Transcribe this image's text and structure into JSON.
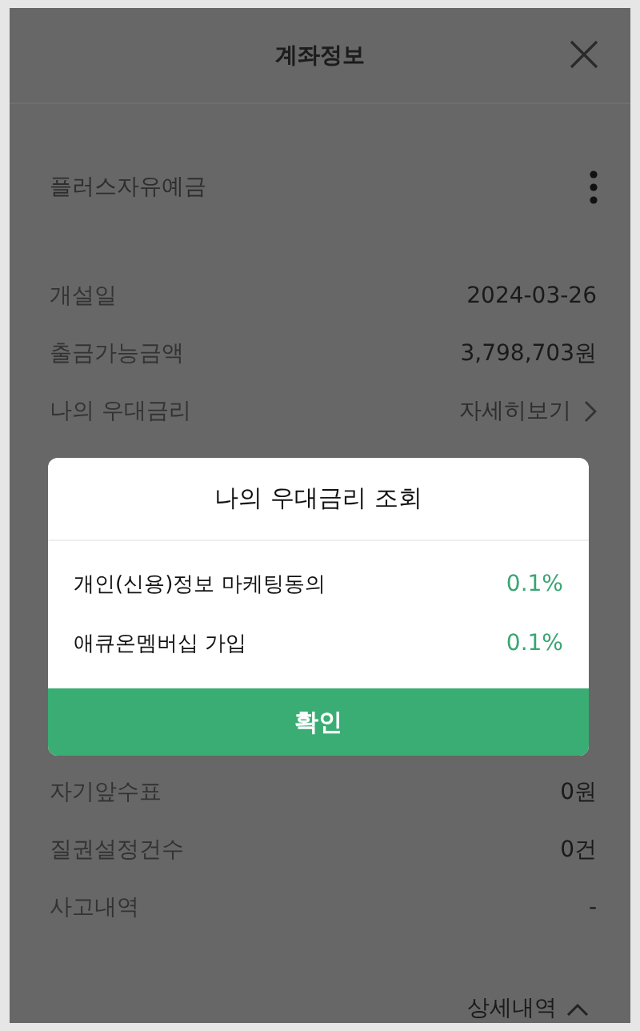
{
  "header": {
    "title": "계좌정보"
  },
  "product": {
    "name": "플러스자유예금"
  },
  "details_top": [
    {
      "kind": "value",
      "label": "개설일",
      "value": "2024-03-26"
    },
    {
      "kind": "value",
      "label": "출금가능금액",
      "value": "3,798,703원"
    },
    {
      "kind": "link",
      "label": "나의 우대금리",
      "value": "자세히보기"
    }
  ],
  "details_bottom": [
    {
      "kind": "value",
      "label": "자기앞수표",
      "value": "0원"
    },
    {
      "kind": "value",
      "label": "질권설정건수",
      "value": "0건"
    },
    {
      "kind": "value",
      "label": "사고내역",
      "value": "-"
    }
  ],
  "more_link": {
    "label": "상세내역",
    "expanded": true
  },
  "dialog": {
    "title": "나의 우대금리 조회",
    "items": [
      {
        "label": "개인(신용)정보 마케팅동의",
        "rate": "0.1%"
      },
      {
        "label": "애큐온멤버십 가입",
        "rate": "0.1%"
      }
    ],
    "confirm": "확인"
  }
}
